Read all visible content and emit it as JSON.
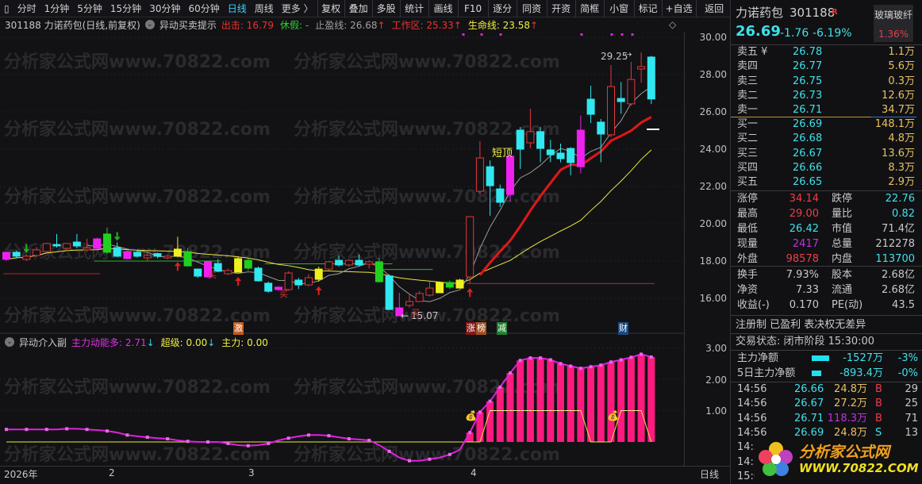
{
  "toolbar": {
    "periods": [
      "分时",
      "1分钟",
      "5分钟",
      "15分钟",
      "30分钟",
      "60分钟",
      "日线",
      "周线",
      "更多 〉"
    ],
    "active": "日线",
    "buttons": [
      "复权",
      "叠加",
      "多股",
      "统计",
      "画线",
      "F10",
      "逐分",
      "同资",
      "开资",
      "简框",
      "小窗",
      "标记",
      "+自选",
      "返回"
    ]
  },
  "legend": {
    "title": "301188 力诺药包(日线,前复权)",
    "indicator": "异动买卖提示",
    "items": [
      {
        "label": "出击: 16.79",
        "color": "#f03030"
      },
      {
        "label": "休假: -",
        "color": "#30d030"
      },
      {
        "label": "止盈线: 26.68",
        "color": "#a0a0a0",
        "arrow": "↑"
      },
      {
        "label": "工作区: 25.33",
        "color": "#f03030",
        "arrow": "↑"
      },
      {
        "label": "生命线: 23.58",
        "color": "#f0f040",
        "arrow": "↑"
      }
    ]
  },
  "ind_legend": {
    "name": "异动介入副",
    "items": [
      {
        "label": "主力动能多: 2.71",
        "color": "#e030e0",
        "arrow": "↓"
      },
      {
        "label": "超级: 0.00",
        "color": "#f0f040",
        "arrow": "↓"
      },
      {
        "label": "主力: 0.00",
        "color": "#f0f040"
      }
    ]
  },
  "price_axis": [
    "30.00",
    "28.00",
    "26.00",
    "24.00",
    "22.00",
    "20.00",
    "18.00",
    "16.00"
  ],
  "ind_axis": [
    "3.00",
    "2.00",
    "1.00"
  ],
  "time_axis": [
    "2026年",
    "2",
    "3",
    "4"
  ],
  "period_label": "日线",
  "annotations": {
    "high": "29.25",
    "low": "15.07",
    "short_top": "短顶",
    "buy": "买"
  },
  "badges": [
    {
      "text": "激",
      "color": "#c05a20"
    },
    {
      "text": "涨",
      "color": "#801818"
    },
    {
      "text": "榜",
      "color": "#a05020"
    },
    {
      "text": "减",
      "color": "#208030"
    },
    {
      "text": "财",
      "color": "#1a4a80"
    }
  ],
  "watermark": "分析家公式网www.70822.com",
  "chart_data": {
    "type": "candlestick",
    "ylim": [
      15,
      30.3
    ],
    "candles": [
      [
        18.47,
        18.5,
        18.0,
        18.09,
        "m"
      ],
      [
        18.47,
        18.55,
        18.2,
        18.26,
        "c"
      ],
      [
        18.09,
        18.35,
        18.0,
        18.26,
        "r"
      ],
      [
        18.3,
        18.75,
        18.2,
        18.6,
        "r"
      ],
      [
        18.51,
        18.94,
        18.45,
        18.94,
        "r"
      ],
      [
        18.89,
        19.45,
        18.72,
        18.81,
        "c"
      ],
      [
        18.68,
        18.95,
        18.6,
        18.94,
        "r"
      ],
      [
        19.02,
        19.45,
        18.7,
        18.81,
        "c"
      ],
      [
        18.6,
        19.2,
        18.5,
        18.7,
        "r"
      ],
      [
        19.19,
        19.25,
        18.6,
        18.68,
        "m"
      ],
      [
        18.47,
        19.79,
        18.4,
        19.45,
        "g"
      ],
      [
        18.72,
        19.0,
        18.2,
        18.26,
        "c"
      ],
      [
        18.51,
        18.55,
        18.1,
        18.13,
        "m"
      ],
      [
        18.47,
        18.6,
        18.2,
        18.26,
        "c"
      ],
      [
        18.17,
        18.45,
        18.0,
        18.3,
        "r"
      ],
      [
        18.4,
        18.45,
        18.15,
        18.26,
        "c"
      ],
      [
        18.17,
        18.3,
        18.1,
        18.26,
        "r"
      ],
      [
        18.64,
        19.3,
        18.2,
        18.26,
        "y"
      ],
      [
        18.51,
        18.7,
        17.7,
        17.74,
        "g"
      ],
      [
        17.57,
        17.6,
        17.1,
        17.19,
        "c"
      ],
      [
        17.96,
        18.0,
        17.1,
        17.15,
        "m"
      ],
      [
        17.87,
        18.1,
        17.4,
        17.45,
        "c"
      ],
      [
        17.32,
        17.6,
        17.25,
        17.49,
        "r"
      ],
      [
        18.13,
        18.2,
        17.4,
        17.4,
        "y"
      ],
      [
        18.04,
        18.15,
        17.5,
        17.62,
        "g"
      ],
      [
        17.62,
        17.7,
        16.9,
        16.94,
        "c"
      ],
      [
        16.81,
        16.9,
        16.3,
        16.38,
        "c"
      ],
      [
        16.6,
        16.65,
        16.4,
        16.47,
        "m"
      ],
      [
        16.47,
        17.45,
        16.4,
        17.36,
        "r"
      ],
      [
        16.98,
        17.1,
        16.5,
        16.72,
        "c"
      ],
      [
        16.72,
        17.3,
        16.65,
        17.11,
        "r"
      ],
      [
        17.57,
        17.7,
        16.9,
        17.02,
        "y"
      ],
      [
        17.57,
        18.0,
        17.5,
        17.96,
        "r"
      ],
      [
        18.04,
        18.3,
        17.7,
        17.79,
        "c"
      ],
      [
        17.79,
        18.1,
        17.7,
        18.04,
        "r"
      ],
      [
        18.04,
        18.35,
        17.7,
        17.79,
        "c"
      ],
      [
        17.83,
        18.05,
        17.6,
        17.96,
        "r"
      ],
      [
        17.96,
        18.15,
        16.85,
        16.89,
        "g"
      ],
      [
        17.2,
        17.3,
        15.4,
        15.4,
        "c"
      ],
      [
        15.49,
        16.3,
        15.06,
        15.06,
        "m"
      ],
      [
        15.62,
        16.2,
        15.5,
        15.83,
        "r"
      ],
      [
        15.83,
        16.4,
        15.8,
        16.26,
        "r"
      ],
      [
        16.17,
        16.9,
        16.1,
        16.55,
        "r"
      ],
      [
        16.85,
        16.9,
        16.3,
        16.3,
        "y"
      ],
      [
        16.85,
        16.95,
        16.5,
        16.6,
        "g"
      ],
      [
        16.98,
        17.05,
        16.55,
        16.55,
        "y"
      ],
      [
        17.15,
        20.4,
        16.8,
        20.38,
        "r"
      ],
      [
        21.74,
        24.43,
        21.6,
        23.53,
        "r"
      ],
      [
        23.06,
        23.4,
        20.43,
        22.04,
        "c"
      ],
      [
        21.87,
        22.1,
        20.9,
        21.15,
        "c"
      ],
      [
        23.62,
        23.7,
        21.2,
        21.57,
        "m"
      ],
      [
        25.02,
        25.19,
        22.94,
        24.0,
        "c"
      ],
      [
        24.34,
        26.17,
        24.04,
        24.94,
        "r"
      ],
      [
        24.94,
        25.19,
        23.3,
        24.04,
        "c"
      ],
      [
        23.96,
        24.5,
        23.3,
        23.7,
        "c"
      ],
      [
        23.79,
        24.3,
        23.3,
        23.49,
        "c"
      ],
      [
        24.04,
        24.1,
        22.6,
        23.28,
        "c"
      ],
      [
        25.02,
        25.8,
        22.7,
        23.06,
        "m"
      ],
      [
        26.68,
        27.4,
        25.4,
        25.87,
        "c"
      ],
      [
        25.45,
        25.62,
        23.3,
        24.81,
        "c"
      ],
      [
        24.77,
        28.51,
        24.64,
        27.36,
        "r"
      ],
      [
        26.72,
        27.6,
        25.9,
        26.55,
        "c"
      ],
      [
        26.43,
        28.68,
        26.34,
        27.74,
        "r"
      ],
      [
        28.3,
        29.19,
        27.57,
        28.43,
        "r"
      ],
      [
        28.94,
        29.0,
        26.42,
        26.69,
        "c"
      ]
    ],
    "hlines": [
      {
        "value": 17.32,
        "from": 0,
        "to": 9,
        "color": "#c02020"
      },
      {
        "value": 18.0,
        "from": 9,
        "to": 21,
        "color": "#30b030"
      },
      {
        "value": 17.85,
        "from": 26,
        "to": 38,
        "color": "#30b030"
      },
      {
        "value": 17.55,
        "from": 37,
        "to": 42,
        "color": "#30b030"
      },
      {
        "value": 16.79,
        "from": 46,
        "to": 64,
        "color": "#d02020"
      }
    ],
    "buy_arrows": [
      17,
      23,
      31,
      46
    ],
    "sell_arrows": [
      2,
      11
    ],
    "indicator": {
      "power": [
        0.4,
        0.4,
        0.4,
        0.4,
        0.4,
        0.4,
        0.42,
        0.42,
        0.4,
        0.38,
        0.35,
        0.3,
        0.22,
        0.18,
        0.15,
        0.12,
        0.1,
        0.05,
        0.02,
        0,
        0,
        0,
        -0.05,
        -0.1,
        -0.12,
        -0.1,
        -0.05,
        0.05,
        0.12,
        0.18,
        0.22,
        0.22,
        0.2,
        0.15,
        0.1,
        0.08,
        0.05,
        -0.1,
        -0.3,
        -0.5,
        -0.6,
        -0.6,
        -0.55,
        -0.5,
        -0.4,
        -0.25,
        0.3,
        0.95,
        1.3,
        1.75,
        2.2,
        2.6,
        2.68,
        2.68,
        2.62,
        2.5,
        2.42,
        2.35,
        2.4,
        2.45,
        2.55,
        2.62,
        2.7,
        2.8,
        2.71
      ],
      "signal_on": [
        [
          48,
          57
        ],
        [
          61,
          63
        ]
      ],
      "ylim": [
        -0.8,
        3.3
      ]
    }
  },
  "quote": {
    "name": "力诺药包",
    "code": "301188",
    "tag": "R",
    "sector": "玻璃玻纤",
    "sector_pct": "1.36%",
    "price": "26.69",
    "change": "-1.76",
    "pct": "-6.19%",
    "asks": [
      [
        "卖五 ¥",
        "26.78",
        "1.1万"
      ],
      [
        "卖四",
        "26.77",
        "5.6万"
      ],
      [
        "卖三",
        "26.75",
        "0.3万"
      ],
      [
        "卖二",
        "26.73",
        "12.6万"
      ],
      [
        "卖一",
        "26.71",
        "34.7万"
      ]
    ],
    "bids": [
      [
        "买一",
        "26.69",
        "148.1万"
      ],
      [
        "买二",
        "26.68",
        "4.8万"
      ],
      [
        "买三",
        "26.67",
        "13.6万"
      ],
      [
        "买四",
        "26.66",
        "8.3万"
      ],
      [
        "买五",
        "26.65",
        "2.9万"
      ]
    ],
    "stats": [
      [
        "涨停",
        "34.14",
        "rd",
        "跌停",
        "22.76",
        "cy"
      ],
      [
        "最高",
        "29.00",
        "rd",
        "量比",
        "0.82",
        "cy"
      ],
      [
        "最低",
        "26.42",
        "cy",
        "市值",
        "71.4亿",
        "gr"
      ],
      [
        "现量",
        "2417",
        "pu",
        "总量",
        "212278",
        "gr"
      ],
      [
        "外盘",
        "98578",
        "rd",
        "内盘",
        "113700",
        "cy"
      ]
    ],
    "stats2": [
      [
        "换手",
        "7.93%",
        "股本",
        "2.68亿"
      ],
      [
        "净资",
        "7.33",
        "流通",
        "2.68亿"
      ],
      [
        "收益(-)",
        "0.170",
        "PE(动)",
        "43.5"
      ]
    ],
    "notice": "注册制 已盈利 表决权无差异",
    "status": "交易状态: 闭市阶段 15:30:00",
    "flows": [
      [
        "主力净额",
        "-1527万",
        "-3%"
      ],
      [
        "5日主力净额",
        "-893.4万",
        "-0%"
      ]
    ],
    "ticks": [
      [
        "14:56",
        "26.66",
        "24.8万",
        "B",
        "29",
        "yl"
      ],
      [
        "14:56",
        "26.67",
        "27.2万",
        "B",
        "25",
        "yl"
      ],
      [
        "14:56",
        "26.71",
        "118.3万",
        "B",
        "71",
        "pu"
      ],
      [
        "14:56",
        "26.69",
        "24.8万",
        "S",
        "13",
        "yl"
      ],
      [
        "14:56",
        "",
        "",
        " ",
        ""
      ],
      [
        "14:56",
        "",
        "",
        " ",
        ""
      ],
      [
        "15:00",
        "",
        "",
        " ",
        ""
      ]
    ],
    "logo_cn": "分析家公式网",
    "logo_url": "WWW.70822.COM"
  }
}
